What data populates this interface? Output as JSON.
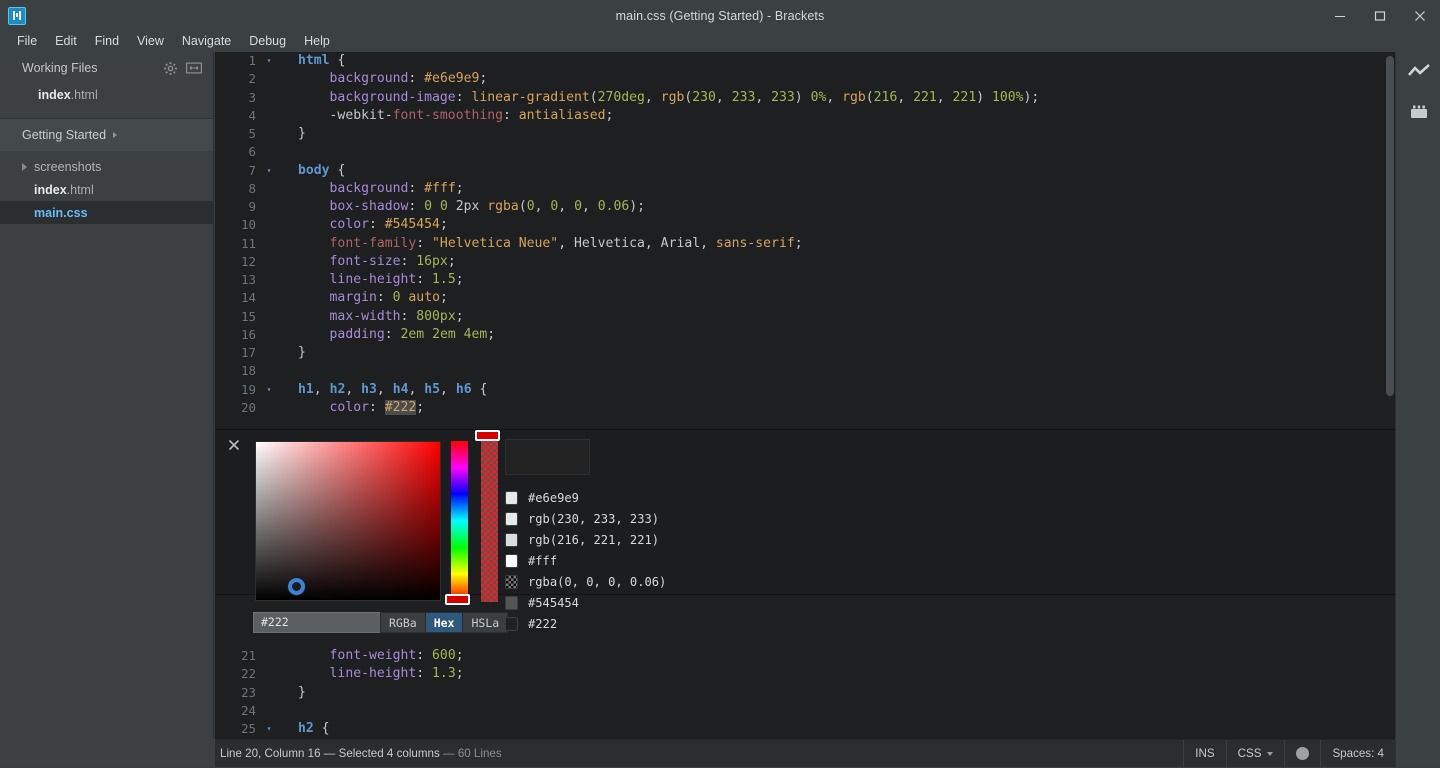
{
  "window": {
    "title": "main.css (Getting Started) - Brackets",
    "app_icon": "brackets-logo-icon",
    "controls": [
      {
        "name": "minimize-button",
        "glyph": "minimize-icon"
      },
      {
        "name": "maximize-button",
        "glyph": "maximize-icon"
      },
      {
        "name": "close-button",
        "glyph": "close-icon"
      }
    ]
  },
  "menubar": {
    "items": [
      {
        "label": "File"
      },
      {
        "label": "Edit"
      },
      {
        "label": "Find"
      },
      {
        "label": "View"
      },
      {
        "label": "Navigate"
      },
      {
        "label": "Debug"
      },
      {
        "label": "Help"
      }
    ]
  },
  "sidebar": {
    "working_files": {
      "title": "Working Files",
      "gear_icon": "gear-icon",
      "split_icon": "split-view-icon",
      "files": [
        {
          "name": "index",
          "ext": ".html",
          "selected": false
        }
      ]
    },
    "project": {
      "name": "Getting Started",
      "caret_icon": "chevron-right-icon",
      "tree": [
        {
          "type": "folder",
          "name": "screenshots",
          "ext": "",
          "selected": false
        },
        {
          "type": "file",
          "name": "index",
          "ext": ".html",
          "selected": false
        },
        {
          "type": "file",
          "name": "main",
          "ext": ".css",
          "selected": true
        }
      ]
    }
  },
  "editor": {
    "language": "CSS",
    "lines_top": [
      {
        "num": "1",
        "fold": "▾",
        "tokens": [
          {
            "t": "tag",
            "v": "html"
          },
          {
            "t": "plain",
            "v": " "
          },
          {
            "t": "brace",
            "v": "{"
          }
        ]
      },
      {
        "num": "2",
        "fold": "",
        "tokens": [
          {
            "t": "plain",
            "v": "    "
          },
          {
            "t": "prop",
            "v": "background"
          },
          {
            "t": "punc",
            "v": ":"
          },
          {
            "t": "plain",
            "v": " "
          },
          {
            "t": "kw",
            "v": "#e6e9e9"
          },
          {
            "t": "punc",
            "v": ";"
          }
        ]
      },
      {
        "num": "3",
        "fold": "",
        "tokens": [
          {
            "t": "plain",
            "v": "    "
          },
          {
            "t": "prop",
            "v": "background-image"
          },
          {
            "t": "punc",
            "v": ":"
          },
          {
            "t": "plain",
            "v": " "
          },
          {
            "t": "func",
            "v": "linear-gradient"
          },
          {
            "t": "punc",
            "v": "("
          },
          {
            "t": "num",
            "v": "270deg"
          },
          {
            "t": "punc",
            "v": ","
          },
          {
            "t": "plain",
            "v": " "
          },
          {
            "t": "func",
            "v": "rgb"
          },
          {
            "t": "punc",
            "v": "("
          },
          {
            "t": "num",
            "v": "230"
          },
          {
            "t": "punc",
            "v": ","
          },
          {
            "t": "plain",
            "v": " "
          },
          {
            "t": "num",
            "v": "233"
          },
          {
            "t": "punc",
            "v": ","
          },
          {
            "t": "plain",
            "v": " "
          },
          {
            "t": "num",
            "v": "233"
          },
          {
            "t": "punc",
            "v": ")"
          },
          {
            "t": "plain",
            "v": " "
          },
          {
            "t": "num",
            "v": "0%"
          },
          {
            "t": "punc",
            "v": ","
          },
          {
            "t": "plain",
            "v": " "
          },
          {
            "t": "func",
            "v": "rgb"
          },
          {
            "t": "punc",
            "v": "("
          },
          {
            "t": "num",
            "v": "216"
          },
          {
            "t": "punc",
            "v": ","
          },
          {
            "t": "plain",
            "v": " "
          },
          {
            "t": "num",
            "v": "221"
          },
          {
            "t": "punc",
            "v": ","
          },
          {
            "t": "plain",
            "v": " "
          },
          {
            "t": "num",
            "v": "221"
          },
          {
            "t": "punc",
            "v": ")"
          },
          {
            "t": "plain",
            "v": " "
          },
          {
            "t": "num",
            "v": "100%"
          },
          {
            "t": "punc",
            "v": ")"
          },
          {
            "t": "punc",
            "v": ";"
          }
        ]
      },
      {
        "num": "4",
        "fold": "",
        "tokens": [
          {
            "t": "plain",
            "v": "    "
          },
          {
            "t": "plain",
            "v": "-webkit-"
          },
          {
            "t": "prop2",
            "v": "font-smoothing"
          },
          {
            "t": "punc",
            "v": ":"
          },
          {
            "t": "plain",
            "v": " "
          },
          {
            "t": "kw",
            "v": "antialiased"
          },
          {
            "t": "punc",
            "v": ";"
          }
        ]
      },
      {
        "num": "5",
        "fold": "",
        "tokens": [
          {
            "t": "brace",
            "v": "}"
          }
        ]
      },
      {
        "num": "6",
        "fold": "",
        "tokens": []
      },
      {
        "num": "7",
        "fold": "▾",
        "tokens": [
          {
            "t": "tag",
            "v": "body"
          },
          {
            "t": "plain",
            "v": " "
          },
          {
            "t": "brace",
            "v": "{"
          }
        ]
      },
      {
        "num": "8",
        "fold": "",
        "tokens": [
          {
            "t": "plain",
            "v": "    "
          },
          {
            "t": "prop",
            "v": "background"
          },
          {
            "t": "punc",
            "v": ":"
          },
          {
            "t": "plain",
            "v": " "
          },
          {
            "t": "kw",
            "v": "#fff"
          },
          {
            "t": "punc",
            "v": ";"
          }
        ]
      },
      {
        "num": "9",
        "fold": "",
        "tokens": [
          {
            "t": "plain",
            "v": "    "
          },
          {
            "t": "prop",
            "v": "box-shadow"
          },
          {
            "t": "punc",
            "v": ":"
          },
          {
            "t": "plain",
            "v": " "
          },
          {
            "t": "num",
            "v": "0"
          },
          {
            "t": "plain",
            "v": " "
          },
          {
            "t": "num",
            "v": "0"
          },
          {
            "t": "plain",
            "v": " "
          },
          {
            "t": "plain",
            "v": "2px"
          },
          {
            "t": "plain",
            "v": " "
          },
          {
            "t": "func",
            "v": "rgba"
          },
          {
            "t": "punc",
            "v": "("
          },
          {
            "t": "num",
            "v": "0"
          },
          {
            "t": "punc",
            "v": ","
          },
          {
            "t": "plain",
            "v": " "
          },
          {
            "t": "num",
            "v": "0"
          },
          {
            "t": "punc",
            "v": ","
          },
          {
            "t": "plain",
            "v": " "
          },
          {
            "t": "num",
            "v": "0"
          },
          {
            "t": "punc",
            "v": ","
          },
          {
            "t": "plain",
            "v": " "
          },
          {
            "t": "num",
            "v": "0.06"
          },
          {
            "t": "punc",
            "v": ")"
          },
          {
            "t": "punc",
            "v": ";"
          }
        ]
      },
      {
        "num": "10",
        "fold": "",
        "tokens": [
          {
            "t": "plain",
            "v": "    "
          },
          {
            "t": "prop",
            "v": "color"
          },
          {
            "t": "punc",
            "v": ":"
          },
          {
            "t": "plain",
            "v": " "
          },
          {
            "t": "kw",
            "v": "#545454"
          },
          {
            "t": "punc",
            "v": ";"
          }
        ]
      },
      {
        "num": "11",
        "fold": "",
        "tokens": [
          {
            "t": "plain",
            "v": "    "
          },
          {
            "t": "prop2",
            "v": "font-family"
          },
          {
            "t": "punc",
            "v": ":"
          },
          {
            "t": "plain",
            "v": " "
          },
          {
            "t": "str",
            "v": "\"Helvetica Neue\""
          },
          {
            "t": "punc",
            "v": ","
          },
          {
            "t": "plain",
            "v": " Helvetica,"
          },
          {
            "t": "plain",
            "v": " Arial,"
          },
          {
            "t": "plain",
            "v": " "
          },
          {
            "t": "kw",
            "v": "sans-serif"
          },
          {
            "t": "punc",
            "v": ";"
          }
        ]
      },
      {
        "num": "12",
        "fold": "",
        "tokens": [
          {
            "t": "plain",
            "v": "    "
          },
          {
            "t": "prop",
            "v": "font-size"
          },
          {
            "t": "punc",
            "v": ":"
          },
          {
            "t": "plain",
            "v": " "
          },
          {
            "t": "num",
            "v": "16px"
          },
          {
            "t": "punc",
            "v": ";"
          }
        ]
      },
      {
        "num": "13",
        "fold": "",
        "tokens": [
          {
            "t": "plain",
            "v": "    "
          },
          {
            "t": "prop",
            "v": "line-height"
          },
          {
            "t": "punc",
            "v": ":"
          },
          {
            "t": "plain",
            "v": " "
          },
          {
            "t": "num",
            "v": "1.5"
          },
          {
            "t": "punc",
            "v": ";"
          }
        ]
      },
      {
        "num": "14",
        "fold": "",
        "tokens": [
          {
            "t": "plain",
            "v": "    "
          },
          {
            "t": "prop",
            "v": "margin"
          },
          {
            "t": "punc",
            "v": ":"
          },
          {
            "t": "plain",
            "v": " "
          },
          {
            "t": "num",
            "v": "0"
          },
          {
            "t": "plain",
            "v": " "
          },
          {
            "t": "kw",
            "v": "auto"
          },
          {
            "t": "punc",
            "v": ";"
          }
        ]
      },
      {
        "num": "15",
        "fold": "",
        "tokens": [
          {
            "t": "plain",
            "v": "    "
          },
          {
            "t": "prop",
            "v": "max-width"
          },
          {
            "t": "punc",
            "v": ":"
          },
          {
            "t": "plain",
            "v": " "
          },
          {
            "t": "num",
            "v": "800px"
          },
          {
            "t": "punc",
            "v": ";"
          }
        ]
      },
      {
        "num": "16",
        "fold": "",
        "tokens": [
          {
            "t": "plain",
            "v": "    "
          },
          {
            "t": "prop",
            "v": "padding"
          },
          {
            "t": "punc",
            "v": ":"
          },
          {
            "t": "plain",
            "v": " "
          },
          {
            "t": "num",
            "v": "2em"
          },
          {
            "t": "plain",
            "v": " "
          },
          {
            "t": "num",
            "v": "2em"
          },
          {
            "t": "plain",
            "v": " "
          },
          {
            "t": "num",
            "v": "4em"
          },
          {
            "t": "punc",
            "v": ";"
          }
        ]
      },
      {
        "num": "17",
        "fold": "",
        "tokens": [
          {
            "t": "brace",
            "v": "}"
          }
        ]
      },
      {
        "num": "18",
        "fold": "",
        "tokens": []
      },
      {
        "num": "19",
        "fold": "▾",
        "tokens": [
          {
            "t": "tag",
            "v": "h1"
          },
          {
            "t": "punc",
            "v": ","
          },
          {
            "t": "plain",
            "v": " "
          },
          {
            "t": "tag",
            "v": "h2"
          },
          {
            "t": "punc",
            "v": ","
          },
          {
            "t": "plain",
            "v": " "
          },
          {
            "t": "tag",
            "v": "h3"
          },
          {
            "t": "punc",
            "v": ","
          },
          {
            "t": "plain",
            "v": " "
          },
          {
            "t": "tag",
            "v": "h4"
          },
          {
            "t": "punc",
            "v": ","
          },
          {
            "t": "plain",
            "v": " "
          },
          {
            "t": "tag",
            "v": "h5"
          },
          {
            "t": "punc",
            "v": ","
          },
          {
            "t": "plain",
            "v": " "
          },
          {
            "t": "tag",
            "v": "h6"
          },
          {
            "t": "plain",
            "v": " "
          },
          {
            "t": "brace",
            "v": "{"
          }
        ]
      },
      {
        "num": "20",
        "fold": "",
        "tokens": [
          {
            "t": "plain",
            "v": "    "
          },
          {
            "t": "prop",
            "v": "color"
          },
          {
            "t": "punc",
            "v": ":"
          },
          {
            "t": "plain",
            "v": " "
          },
          {
            "t": "kw sel",
            "v": "#222"
          },
          {
            "t": "punc",
            "v": ";"
          }
        ]
      }
    ],
    "lines_bottom": [
      {
        "num": "21",
        "fold": "",
        "tokens": [
          {
            "t": "plain",
            "v": "    "
          },
          {
            "t": "prop",
            "v": "font-weight"
          },
          {
            "t": "punc",
            "v": ":"
          },
          {
            "t": "plain",
            "v": " "
          },
          {
            "t": "num",
            "v": "600"
          },
          {
            "t": "punc",
            "v": ";"
          }
        ]
      },
      {
        "num": "22",
        "fold": "",
        "tokens": [
          {
            "t": "plain",
            "v": "    "
          },
          {
            "t": "prop",
            "v": "line-height"
          },
          {
            "t": "punc",
            "v": ":"
          },
          {
            "t": "plain",
            "v": " "
          },
          {
            "t": "num",
            "v": "1.3"
          },
          {
            "t": "punc",
            "v": ";"
          }
        ]
      },
      {
        "num": "23",
        "fold": "",
        "tokens": [
          {
            "t": "brace",
            "v": "}"
          }
        ]
      },
      {
        "num": "24",
        "fold": "",
        "tokens": []
      },
      {
        "num": "25",
        "fold": "▾",
        "tokens": [
          {
            "t": "tag",
            "v": "h2"
          },
          {
            "t": "plain",
            "v": " "
          },
          {
            "t": "brace",
            "v": "{"
          }
        ]
      }
    ]
  },
  "colorpicker": {
    "close_icon": "close-icon",
    "hex_value": "#222",
    "hex_placeholder": "#222",
    "current_color": "#222222",
    "formats": [
      {
        "label": "RGBa",
        "active": false
      },
      {
        "label": "Hex",
        "active": true
      },
      {
        "label": "HSLa",
        "active": false
      }
    ],
    "swatches": [
      {
        "label": "#e6e9e9",
        "color": "#e6e9e9",
        "checker": false
      },
      {
        "label": "rgb(230, 233, 233)",
        "color": "#e6e9e9",
        "checker": false
      },
      {
        "label": "rgb(216, 221, 221)",
        "color": "#d8dddd",
        "checker": false
      },
      {
        "label": "#fff",
        "color": "#ffffff",
        "checker": false
      },
      {
        "label": "rgba(0, 0, 0, 0.06)",
        "color": "rgba(0,0,0,0.06)",
        "checker": true
      },
      {
        "label": "#545454",
        "color": "#545454",
        "checker": false
      },
      {
        "label": "#222",
        "color": "#222222",
        "checker": false
      }
    ]
  },
  "right_toolbar": {
    "items": [
      {
        "name": "live-preview-icon"
      },
      {
        "name": "extension-manager-icon"
      }
    ]
  },
  "statusbar": {
    "cursor_info": "Line 20, Column 16 — Selected 4 columns",
    "line_count": "— 60 Lines",
    "insert_mode": "INS",
    "language": "CSS",
    "lang_caret_icon": "chevron-down-icon",
    "busy_indicator": "busy-dot-icon",
    "indent": "Spaces: 4"
  },
  "colors": {
    "chrome": "#3b4043",
    "sidebar": "#3c4043",
    "editor_bg": "#1d1f21",
    "accent_blue": "#6bb9f0",
    "selection": "#4a4d50"
  }
}
